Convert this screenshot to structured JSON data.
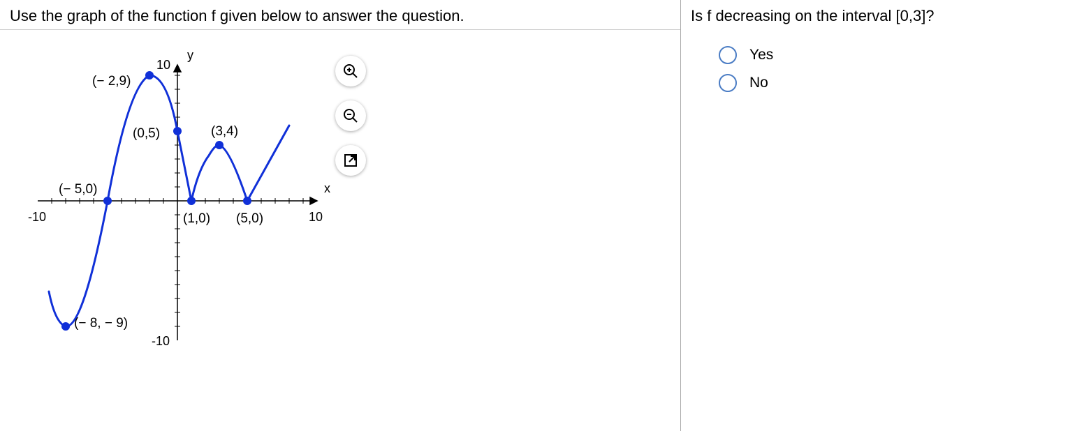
{
  "left": {
    "instruction": "Use the graph of the function f given below to answer the question."
  },
  "right": {
    "question": "Is f decreasing on the interval [0,3]?",
    "options": [
      "Yes",
      "No"
    ]
  },
  "graph": {
    "x_axis_label": "x",
    "y_axis_label": "y",
    "x_min_tick": "-10",
    "x_max_tick": "10",
    "y_max_tick": "10",
    "y_min_tick": "-10",
    "point_labels": {
      "p1": "(− 2,9)",
      "p2": "(0,5)",
      "p3": "(3,4)",
      "p4": "(− 5,0)",
      "p5": "(1,0)",
      "p6": "(5,0)",
      "p7": "(− 8, − 9)"
    }
  },
  "chart_data": {
    "type": "line",
    "title": "",
    "xlabel": "x",
    "ylabel": "y",
    "xlim": [
      -10,
      10
    ],
    "ylim": [
      -10,
      10
    ],
    "marked_points": [
      {
        "x": -8,
        "y": -9,
        "label": "(-8,-9)"
      },
      {
        "x": -5,
        "y": 0,
        "label": "(-5,0)"
      },
      {
        "x": -2,
        "y": 9,
        "label": "(-2,9)"
      },
      {
        "x": 0,
        "y": 5,
        "label": "(0,5)"
      },
      {
        "x": 1,
        "y": 0,
        "label": "(1,0)"
      },
      {
        "x": 3,
        "y": 4,
        "label": "(3,4)"
      },
      {
        "x": 5,
        "y": 0,
        "label": "(5,0)"
      }
    ],
    "series": [
      {
        "name": "f",
        "x": [
          -9.2,
          -9,
          -8.5,
          -8,
          -7.5,
          -7,
          -6.5,
          -6,
          -5.5,
          -5,
          -4.5,
          -4,
          -3.5,
          -3,
          -2.5,
          -2,
          -1.5,
          -1,
          -0.5,
          0,
          0.5,
          1,
          1.5,
          2,
          2.5,
          3,
          3.5,
          4,
          4.5,
          5,
          5.5,
          6,
          6.5,
          7,
          7.5,
          8
        ],
        "y": [
          -6.5,
          -7.8,
          -8.8,
          -9,
          -8.5,
          -7.3,
          -5.6,
          -3.6,
          -1.7,
          0,
          1.8,
          3.8,
          5.8,
          7.5,
          8.6,
          9,
          8.6,
          7.6,
          6.4,
          5,
          2.5,
          0,
          1.4,
          2.9,
          3.8,
          4,
          3.6,
          2.6,
          1.3,
          0,
          0.9,
          1.8,
          2.7,
          3.6,
          4.5,
          5.4
        ]
      }
    ]
  }
}
